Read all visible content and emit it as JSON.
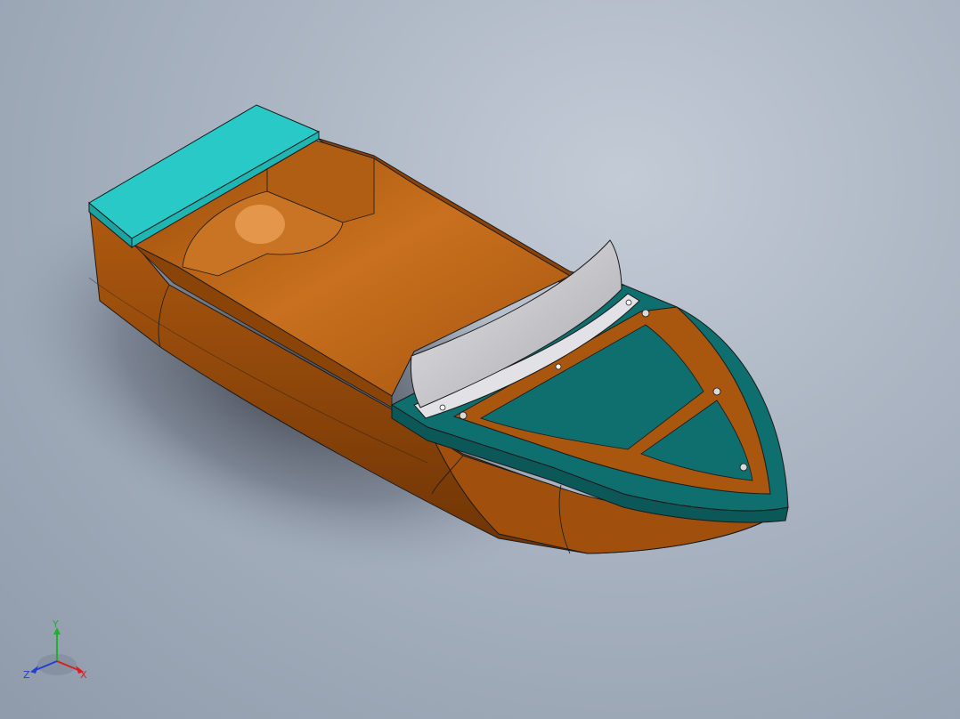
{
  "viewport": {
    "background_top": "#c3cbd6",
    "background_bottom": "#8f9bab"
  },
  "model": {
    "hull_color": "#b85d12",
    "hull_dark": "#7a3a05",
    "interior_color": "#c06a1c",
    "deck_color": "#0f6e6e",
    "rear_seat_color": "#28c9c6",
    "windshield_color": "#c9c9cd",
    "outline_color": "#1a1a1a"
  },
  "triad": {
    "x_label": "X",
    "y_label": "Y",
    "z_label": "Z",
    "x_color": "#d42020",
    "y_color": "#20b030",
    "z_color": "#2040d0"
  }
}
